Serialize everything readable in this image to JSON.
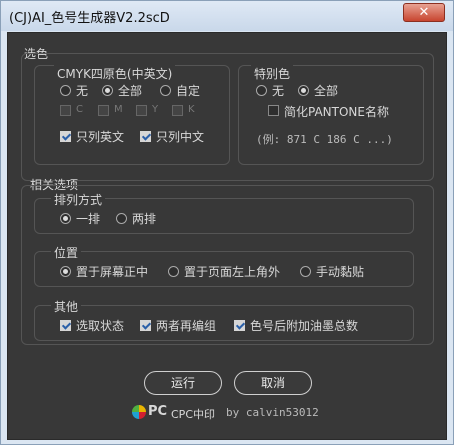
{
  "window": {
    "title": "(CJ)AI_色号生成器V2.2scD",
    "close": "✕"
  },
  "color_section": {
    "label": "选色"
  },
  "cmyk": {
    "label": "CMYK四原色(中英文)",
    "options": [
      "无",
      "全部",
      "自定"
    ],
    "selected": "全部",
    "channels": [
      "C",
      "M",
      "Y",
      "K"
    ],
    "checkboxes": [
      {
        "label": "只列英文",
        "checked": true
      },
      {
        "label": "只列中文",
        "checked": true
      }
    ]
  },
  "spot": {
    "label": "特别色",
    "options": [
      "无",
      "全部"
    ],
    "selected": "全部",
    "pantone": {
      "label": "简化PANTONE名称",
      "checked": false
    },
    "example": "(例: 871 C 186 C ...)"
  },
  "related": {
    "label": "相关选项"
  },
  "arrange": {
    "label": "排列方式",
    "options": [
      "一排",
      "两排"
    ],
    "selected": "一排"
  },
  "position": {
    "label": "位置",
    "options": [
      "置于屏幕正中",
      "置于页面左上角外",
      "手动黏贴"
    ],
    "selected": "置于屏幕正中"
  },
  "other": {
    "label": "其他",
    "checkboxes": [
      {
        "label": "选取状态",
        "checked": true
      },
      {
        "label": "两者再编组",
        "checked": true
      },
      {
        "label": "色号后附加油墨总数",
        "checked": true
      }
    ]
  },
  "buttons": {
    "run": "运行",
    "cancel": "取消"
  },
  "footer": {
    "brand": "CPC中印",
    "credit": "by calvin53012"
  }
}
